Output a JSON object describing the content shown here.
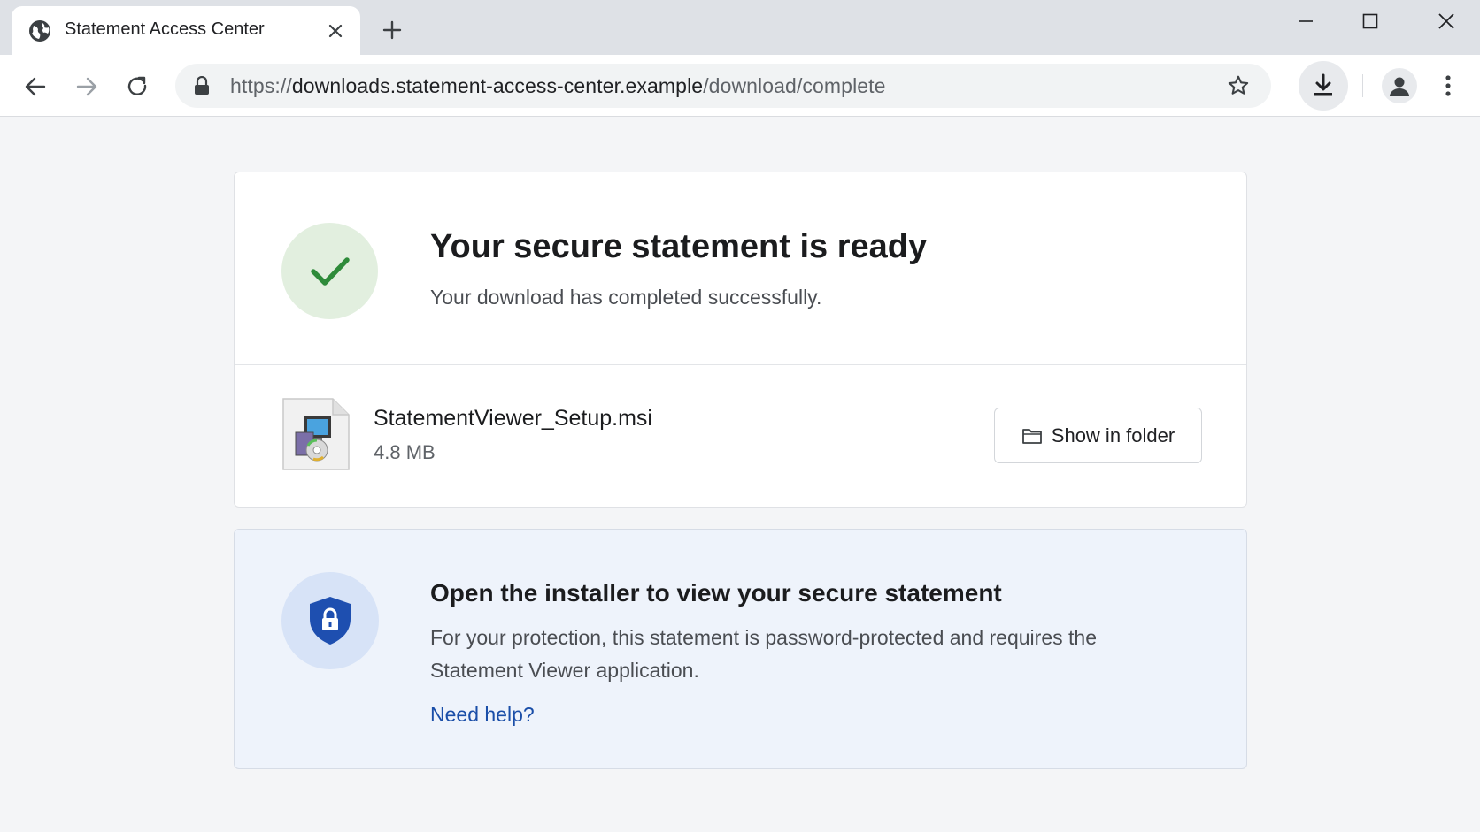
{
  "browser": {
    "tab": {
      "title": "Statement Access Center",
      "favicon": "globe-icon"
    },
    "address": {
      "scheme": "https://",
      "host": "downloads.statement-access-center.example",
      "path": "/download/complete"
    },
    "icons": [
      "back-icon",
      "forward-icon",
      "reload-icon",
      "lock-icon",
      "star-icon",
      "download-icon",
      "profile-icon",
      "menu-icon",
      "minimize-icon",
      "maximize-icon",
      "close-icon"
    ]
  },
  "page": {
    "status": {
      "title": "Your secure statement is ready",
      "subtitle": "Your download has completed successfully."
    },
    "file": {
      "name": "StatementViewer_Setup.msi",
      "size": "4.8 MB",
      "action_label": "Show in folder"
    },
    "notice": {
      "title": "Open the installer to view your secure statement",
      "body": "For your protection, this statement is password-protected and requires the Statement Viewer application.",
      "help_link": "Need help?"
    }
  },
  "colors": {
    "success_bg": "#e2efdf",
    "success_check": "#2e8b3a",
    "shield": "#1e4fb0",
    "link": "#1a4ea8"
  }
}
